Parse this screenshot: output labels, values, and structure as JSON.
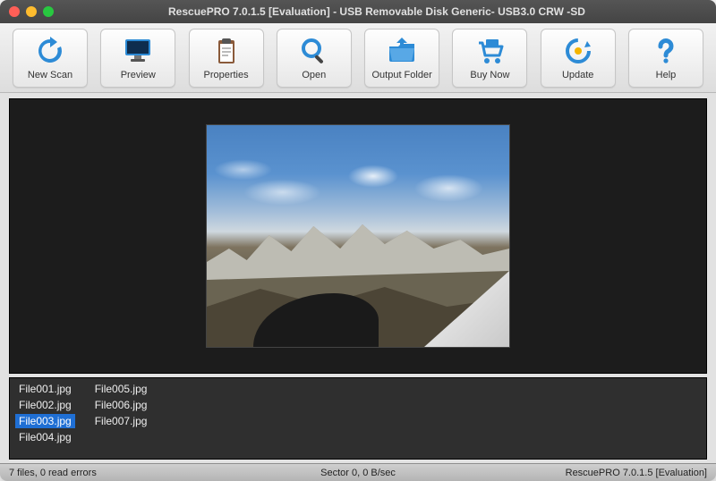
{
  "window": {
    "title": "RescuePRO 7.0.1.5 [Evaluation] - USB Removable Disk Generic- USB3.0 CRW   -SD"
  },
  "toolbar": {
    "new_scan": "New Scan",
    "preview": "Preview",
    "properties": "Properties",
    "open": "Open",
    "output_folder": "Output Folder",
    "buy_now": "Buy Now",
    "update": "Update",
    "help": "Help"
  },
  "files": [
    {
      "name": "File001.jpg",
      "selected": false
    },
    {
      "name": "File002.jpg",
      "selected": false
    },
    {
      "name": "File003.jpg",
      "selected": true
    },
    {
      "name": "File004.jpg",
      "selected": false
    },
    {
      "name": "File005.jpg",
      "selected": false
    },
    {
      "name": "File006.jpg",
      "selected": false
    },
    {
      "name": "File007.jpg",
      "selected": false
    }
  ],
  "status": {
    "left": "7 files, 0 read errors",
    "center": "Sector 0, 0 B/sec",
    "right": "RescuePRO 7.0.1.5 [Evaluation]"
  },
  "colors": {
    "icon_blue": "#1f7fd0",
    "selected": "#1f6fd4"
  },
  "preview_image": {
    "description": "mountain landscape photo viewed from aircraft",
    "filename": "File003.jpg"
  }
}
